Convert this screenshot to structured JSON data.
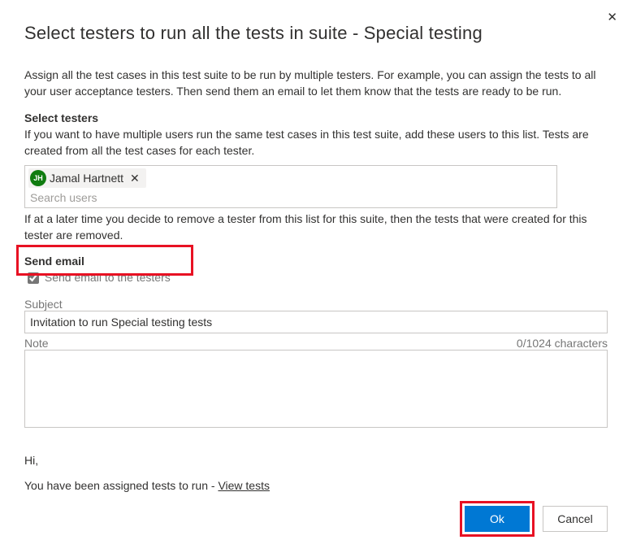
{
  "dialog": {
    "title": "Select testers to run all the tests in suite - Special testing",
    "description": "Assign all the test cases in this test suite to be run by multiple testers. For example, you can assign the tests to all your user acceptance testers. Then send them an email to let them know that the tests are ready to be run."
  },
  "testers": {
    "section_title": "Select testers",
    "help": "If you want to have multiple users run the same test cases in this test suite, add these users to this list. Tests are created from all the test cases for each tester.",
    "chips": [
      {
        "name": "Jamal Hartnett",
        "initials": "JH"
      }
    ],
    "search_placeholder": "Search users",
    "removal_note": "If at a later time you decide to remove a tester from this list for this suite, then the tests that were created for this tester are removed."
  },
  "email": {
    "section_title": "Send email",
    "checkbox_label": "Send email to the testers",
    "checked": true,
    "subject_label": "Subject",
    "subject_value": "Invitation to run Special testing tests",
    "note_label": "Note",
    "char_count": "0/1024 characters",
    "preview_greeting": "Hi,",
    "preview_body": "You have been assigned tests to run - ",
    "preview_link": "View tests"
  },
  "buttons": {
    "ok": "Ok",
    "cancel": "Cancel"
  }
}
